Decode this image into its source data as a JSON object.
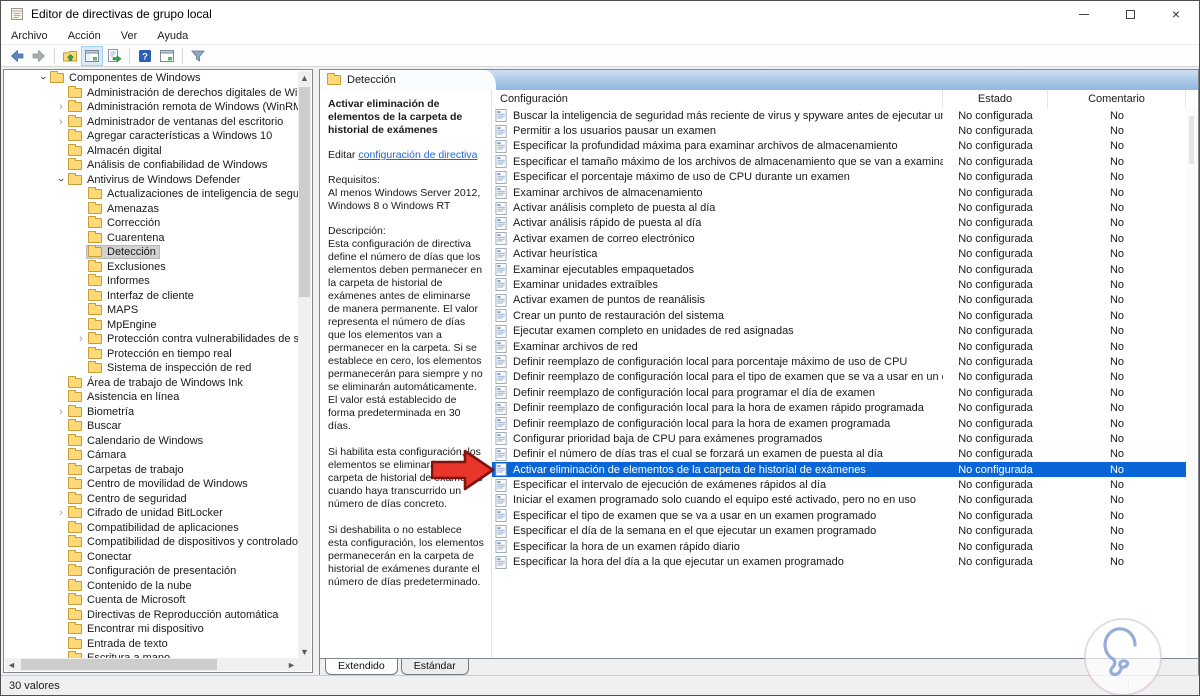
{
  "window": {
    "title": "Editor de directivas de grupo local",
    "controls": [
      {
        "name": "minimize-button",
        "glyph": ""
      },
      {
        "name": "maximize-button",
        "glyph": ""
      },
      {
        "name": "close-button",
        "glyph": "×"
      }
    ]
  },
  "menu": {
    "items": [
      "Archivo",
      "Acción",
      "Ver",
      "Ayuda"
    ]
  },
  "toolbar": {
    "icons": [
      {
        "name": "back-icon"
      },
      {
        "name": "forward-icon"
      },
      {
        "name": "separator"
      },
      {
        "name": "up-one-level-icon"
      },
      {
        "name": "show-console-tree-icon",
        "active": true
      },
      {
        "name": "export-list-icon"
      },
      {
        "name": "separator"
      },
      {
        "name": "help-icon"
      },
      {
        "name": "console-window-icon"
      },
      {
        "name": "separator"
      },
      {
        "name": "filter-icon"
      }
    ]
  },
  "tree": {
    "items": [
      {
        "label": "Componentes de Windows",
        "level": 1,
        "arrow": "expanded",
        "selected": false
      },
      {
        "label": "Administración de derechos digitales de Windows",
        "level": 2,
        "arrow": "none",
        "selected": false
      },
      {
        "label": "Administración remota de Windows (WinRM)",
        "level": 2,
        "arrow": "collapsed",
        "selected": false
      },
      {
        "label": "Administrador de ventanas del escritorio",
        "level": 2,
        "arrow": "collapsed",
        "selected": false
      },
      {
        "label": "Agregar características a Windows 10",
        "level": 2,
        "arrow": "none",
        "selected": false
      },
      {
        "label": "Almacén digital",
        "level": 2,
        "arrow": "none",
        "selected": false
      },
      {
        "label": "Análisis de confiabilidad de Windows",
        "level": 2,
        "arrow": "none",
        "selected": false
      },
      {
        "label": "Antivirus de Windows Defender",
        "level": 2,
        "arrow": "expanded",
        "selected": false
      },
      {
        "label": "Actualizaciones de inteligencia de seguridad",
        "level": 3,
        "arrow": "none",
        "selected": false
      },
      {
        "label": "Amenazas",
        "level": 3,
        "arrow": "none",
        "selected": false
      },
      {
        "label": "Corrección",
        "level": 3,
        "arrow": "none",
        "selected": false
      },
      {
        "label": "Cuarentena",
        "level": 3,
        "arrow": "none",
        "selected": false
      },
      {
        "label": "Detección",
        "level": 3,
        "arrow": "none",
        "selected": true
      },
      {
        "label": "Exclusiones",
        "level": 3,
        "arrow": "none",
        "selected": false
      },
      {
        "label": "Informes",
        "level": 3,
        "arrow": "none",
        "selected": false
      },
      {
        "label": "Interfaz de cliente",
        "level": 3,
        "arrow": "none",
        "selected": false
      },
      {
        "label": "MAPS",
        "level": 3,
        "arrow": "none",
        "selected": false
      },
      {
        "label": "MpEngine",
        "level": 3,
        "arrow": "none",
        "selected": false
      },
      {
        "label": "Protección contra vulnerabilidades de seguridad",
        "level": 3,
        "arrow": "collapsed",
        "selected": false
      },
      {
        "label": "Protección en tiempo real",
        "level": 3,
        "arrow": "none",
        "selected": false
      },
      {
        "label": "Sistema de inspección de red",
        "level": 3,
        "arrow": "none",
        "selected": false
      },
      {
        "label": "Área de trabajo de Windows Ink",
        "level": 2,
        "arrow": "none",
        "selected": false
      },
      {
        "label": "Asistencia en línea",
        "level": 2,
        "arrow": "none",
        "selected": false
      },
      {
        "label": "Biometría",
        "level": 2,
        "arrow": "collapsed",
        "selected": false
      },
      {
        "label": "Buscar",
        "level": 2,
        "arrow": "none",
        "selected": false
      },
      {
        "label": "Calendario de Windows",
        "level": 2,
        "arrow": "none",
        "selected": false
      },
      {
        "label": "Cámara",
        "level": 2,
        "arrow": "none",
        "selected": false
      },
      {
        "label": "Carpetas de trabajo",
        "level": 2,
        "arrow": "none",
        "selected": false
      },
      {
        "label": "Centro de movilidad de Windows",
        "level": 2,
        "arrow": "none",
        "selected": false
      },
      {
        "label": "Centro de seguridad",
        "level": 2,
        "arrow": "none",
        "selected": false
      },
      {
        "label": "Cifrado de unidad BitLocker",
        "level": 2,
        "arrow": "collapsed",
        "selected": false
      },
      {
        "label": "Compatibilidad de aplicaciones",
        "level": 2,
        "arrow": "none",
        "selected": false
      },
      {
        "label": "Compatibilidad de dispositivos y controladores",
        "level": 2,
        "arrow": "none",
        "selected": false
      },
      {
        "label": "Conectar",
        "level": 2,
        "arrow": "none",
        "selected": false
      },
      {
        "label": "Configuración de presentación",
        "level": 2,
        "arrow": "none",
        "selected": false
      },
      {
        "label": "Contenido de la nube",
        "level": 2,
        "arrow": "none",
        "selected": false
      },
      {
        "label": "Cuenta de Microsoft",
        "level": 2,
        "arrow": "none",
        "selected": false
      },
      {
        "label": "Directivas de Reproducción automática",
        "level": 2,
        "arrow": "none",
        "selected": false
      },
      {
        "label": "Encontrar mi dispositivo",
        "level": 2,
        "arrow": "none",
        "selected": false
      },
      {
        "label": "Entrada de texto",
        "level": 2,
        "arrow": "none",
        "selected": false
      },
      {
        "label": "Escritura a mano",
        "level": 2,
        "arrow": "none",
        "selected": false
      }
    ]
  },
  "detail_header": {
    "label": "Detección"
  },
  "description_panel": {
    "title": "Activar eliminación de elementos de la carpeta de historial de exámenes",
    "edit_prefix": "Editar ",
    "edit_link": "configuración de directiva",
    "requirements_label": "Requisitos:",
    "requirements": "Al menos Windows Server 2012, Windows 8 o Windows RT",
    "description_label": "Descripción:",
    "paragraphs": [
      "Esta configuración de directiva define el número de días que los elementos deben permanecer en la carpeta de historial de exámenes antes de eliminarse de manera permanente. El valor representa el número de días que los elementos van a permanecer en la carpeta. Si se establece en cero, los elementos permanecerán para siempre y no se eliminarán automáticamente. El valor está establecido de forma predeterminada en 30 días.",
      "Si habilita esta configuración, los elementos se eliminarán de la carpeta de historial de exámenes cuando haya transcurrido un número de días concreto.",
      "Si deshabilita o no establece esta configuración, los elementos permanecerán en la carpeta de historial de exámenes durante el número de días predeterminado."
    ]
  },
  "list": {
    "columns": [
      "Configuración",
      "Estado",
      "Comentario"
    ],
    "rows": [
      {
        "name": "Buscar la inteligencia de seguridad más reciente de virus y spyware antes de ejecutar un examen pro...",
        "estado": "No configurada",
        "comentario": "No",
        "selected": false
      },
      {
        "name": "Permitir a los usuarios pausar un examen",
        "estado": "No configurada",
        "comentario": "No",
        "selected": false
      },
      {
        "name": "Especificar la profundidad máxima para examinar archivos de almacenamiento",
        "estado": "No configurada",
        "comentario": "No",
        "selected": false
      },
      {
        "name": "Especificar el tamaño máximo de los archivos de almacenamiento que se van a examinar",
        "estado": "No configurada",
        "comentario": "No",
        "selected": false
      },
      {
        "name": "Especificar el porcentaje máximo de uso de CPU durante un examen",
        "estado": "No configurada",
        "comentario": "No",
        "selected": false
      },
      {
        "name": "Examinar archivos de almacenamiento",
        "estado": "No configurada",
        "comentario": "No",
        "selected": false
      },
      {
        "name": "Activar análisis completo de puesta al día",
        "estado": "No configurada",
        "comentario": "No",
        "selected": false
      },
      {
        "name": "Activar análisis rápido de puesta al día",
        "estado": "No configurada",
        "comentario": "No",
        "selected": false
      },
      {
        "name": "Activar examen de correo electrónico",
        "estado": "No configurada",
        "comentario": "No",
        "selected": false
      },
      {
        "name": "Activar heurística",
        "estado": "No configurada",
        "comentario": "No",
        "selected": false
      },
      {
        "name": "Examinar ejecutables empaquetados",
        "estado": "No configurada",
        "comentario": "No",
        "selected": false
      },
      {
        "name": "Examinar unidades extraíbles",
        "estado": "No configurada",
        "comentario": "No",
        "selected": false
      },
      {
        "name": "Activar examen de puntos de reanálisis",
        "estado": "No configurada",
        "comentario": "No",
        "selected": false
      },
      {
        "name": "Crear un punto de restauración del sistema",
        "estado": "No configurada",
        "comentario": "No",
        "selected": false
      },
      {
        "name": "Ejecutar examen completo en unidades de red asignadas",
        "estado": "No configurada",
        "comentario": "No",
        "selected": false
      },
      {
        "name": "Examinar archivos de red",
        "estado": "No configurada",
        "comentario": "No",
        "selected": false
      },
      {
        "name": "Definir reemplazo de configuración local para porcentaje máximo de uso de CPU",
        "estado": "No configurada",
        "comentario": "No",
        "selected": false
      },
      {
        "name": "Definir reemplazo de configuración local para el tipo de examen que se va a usar en un examen pro...",
        "estado": "No configurada",
        "comentario": "No",
        "selected": false
      },
      {
        "name": "Definir reemplazo de configuración local para programar el día de examen",
        "estado": "No configurada",
        "comentario": "No",
        "selected": false
      },
      {
        "name": "Definir reemplazo de configuración local para la hora de examen rápido programada",
        "estado": "No configurada",
        "comentario": "No",
        "selected": false
      },
      {
        "name": "Definir reemplazo de configuración local para la hora de examen programada",
        "estado": "No configurada",
        "comentario": "No",
        "selected": false
      },
      {
        "name": "Configurar prioridad baja de CPU para exámenes programados",
        "estado": "No configurada",
        "comentario": "No",
        "selected": false
      },
      {
        "name": "Definir el número de días tras el cual se forzará un examen de puesta al día",
        "estado": "No configurada",
        "comentario": "No",
        "selected": false
      },
      {
        "name": "Activar eliminación de elementos de la carpeta de historial de exámenes",
        "estado": "No configurada",
        "comentario": "No",
        "selected": true
      },
      {
        "name": "Especificar el intervalo de ejecución de exámenes rápidos al día",
        "estado": "No configurada",
        "comentario": "No",
        "selected": false
      },
      {
        "name": "Iniciar el examen programado solo cuando el equipo esté activado, pero no en uso",
        "estado": "No configurada",
        "comentario": "No",
        "selected": false
      },
      {
        "name": "Especificar el tipo de examen que se va a usar en un examen programado",
        "estado": "No configurada",
        "comentario": "No",
        "selected": false
      },
      {
        "name": "Especificar el día de la semana en el que ejecutar un examen programado",
        "estado": "No configurada",
        "comentario": "No",
        "selected": false
      },
      {
        "name": "Especificar la hora de un examen rápido diario",
        "estado": "No configurada",
        "comentario": "No",
        "selected": false
      },
      {
        "name": "Especificar la hora del día a la que ejecutar un examen programado",
        "estado": "No configurada",
        "comentario": "No",
        "selected": false
      }
    ]
  },
  "tabs": {
    "items": [
      "Extendido",
      "Estándar"
    ],
    "active": "Extendido"
  },
  "status_bar": {
    "text": "30 valores"
  },
  "colors": {
    "selection_blue": "#0a66d6",
    "arrow_red": "#e8362a",
    "arrow_red_border": "#7e1410",
    "header_blue": "#a9c7e8",
    "folder_yellow": "#ffd977",
    "link_blue": "#2266cc"
  }
}
